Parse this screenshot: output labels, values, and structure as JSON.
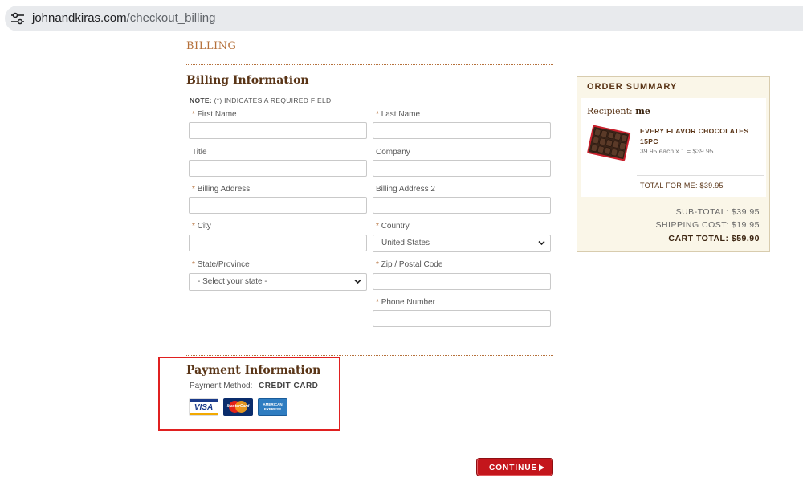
{
  "browser": {
    "url_domain": "johnandkiras.com",
    "url_path": "/checkout_billing"
  },
  "breadcrumb": "BILLING",
  "billing": {
    "title": "Billing Information",
    "note_label": "NOTE:",
    "note_text": "(*) INDICATES A REQUIRED FIELD",
    "required_mark": "*",
    "fields": {
      "first_name": "First Name",
      "last_name": "Last Name",
      "title": "Title",
      "company": "Company",
      "address1": "Billing Address",
      "address2": "Billing Address 2",
      "city": "City",
      "country": "Country",
      "country_value": "United States",
      "state": "State/Province",
      "state_value": "- Select your state -",
      "zip": "Zip / Postal Code",
      "phone": "Phone Number"
    }
  },
  "payment": {
    "title": "Payment Information",
    "method_label": "Payment Method:",
    "method_value": "CREDIT CARD",
    "cards": {
      "visa": "VISA",
      "mastercard": "MasterCard",
      "amex_line1": "AMERICAN",
      "amex_line2": "EXPRESS"
    }
  },
  "continue_label": "CONTINUE",
  "order_summary": {
    "title": "ORDER SUMMARY",
    "recipient_label": "Recipient:",
    "recipient_name": "me",
    "product_name": "EVERY FLAVOR CHOCOLATES 15PC",
    "product_price": "39.95 each x 1 = $39.95",
    "total_for_me": "TOTAL FOR ME: $39.95",
    "subtotal": "SUB-TOTAL: $39.95",
    "shipping": "SHIPPING COST: $19.95",
    "cart_total": "CART TOTAL: $59.90"
  },
  "colors": {
    "accent": "#b5703a",
    "heading": "#5a3517",
    "button": "#c4161c",
    "highlight_box": "#e02020"
  },
  "icons": [
    "tune-icon",
    "chevron-down-icon",
    "play-arrow-icon"
  ]
}
